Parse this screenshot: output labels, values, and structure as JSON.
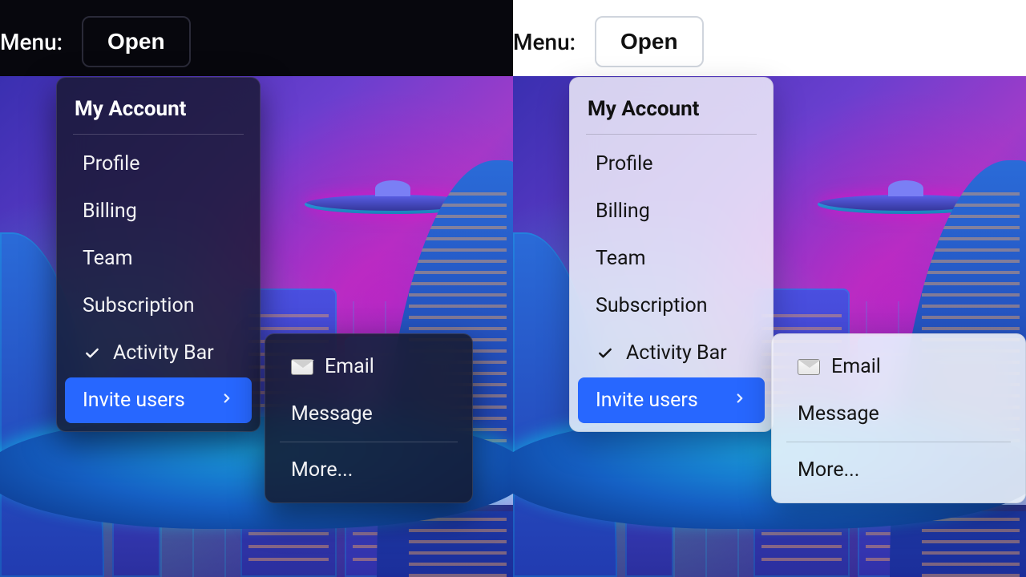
{
  "header": {
    "label": "Menu:",
    "button": "Open"
  },
  "menu": {
    "title": "My Account",
    "items": {
      "profile": "Profile",
      "billing": "Billing",
      "team": "Team",
      "subscription": "Subscription",
      "activity": "Activity Bar",
      "invite": "Invite users"
    }
  },
  "submenu": {
    "email": "Email",
    "message": "Message",
    "more": "More..."
  },
  "themes": [
    "dark",
    "light"
  ],
  "colors": {
    "accent": "#2767ff"
  }
}
